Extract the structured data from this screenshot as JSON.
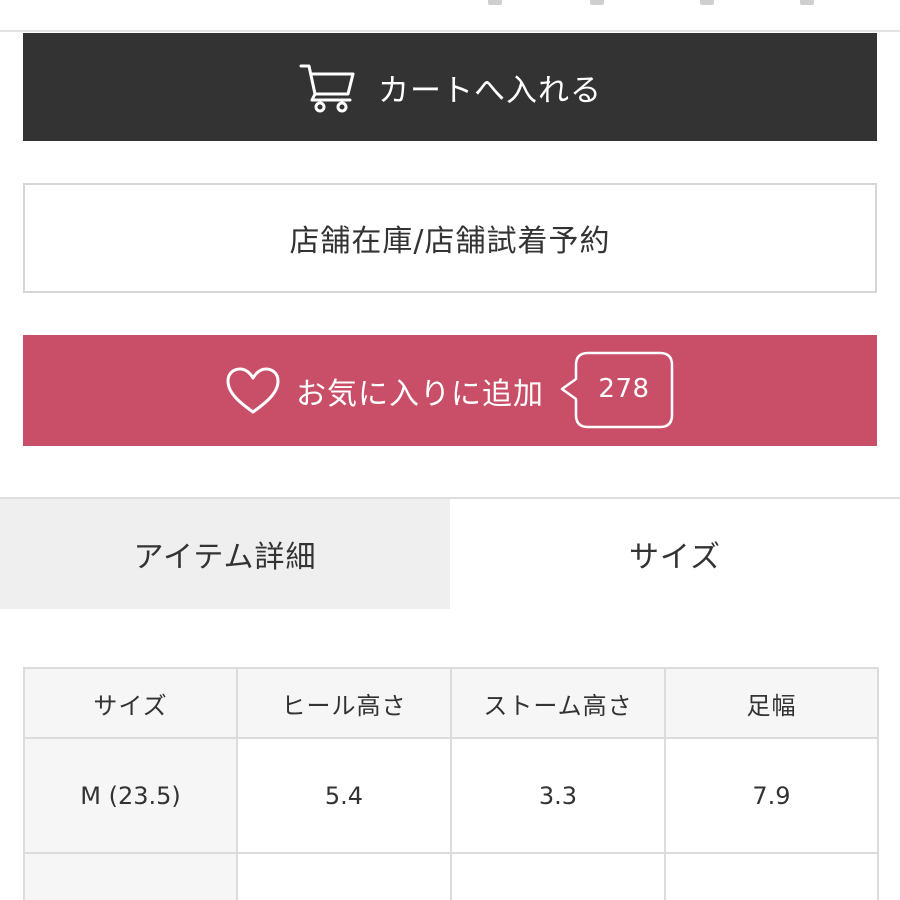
{
  "actions": {
    "cart_label": "カートへ入れる",
    "store_label": "店舗在庫/店舗試着予約",
    "favorite_label": "お気に入りに追加",
    "favorite_count": "278"
  },
  "tabs": [
    {
      "label": "アイテム詳細",
      "active": false
    },
    {
      "label": "サイズ",
      "active": true
    }
  ],
  "size_table": {
    "headers": [
      "サイズ",
      "ヒール高さ",
      "ストーム高さ",
      "足幅"
    ],
    "rows": [
      [
        "M (23.5)",
        "5.4",
        "3.3",
        "7.9"
      ]
    ]
  },
  "icons": {
    "cart": "cart-icon",
    "favorite": "heart-icon",
    "count_bubble": "speech-bubble-icon"
  },
  "colors": {
    "cart_button": "#333333",
    "favorite_button": "#c94f68",
    "inactive_tab": "#efefef",
    "table_header_bg": "#f6f6f6",
    "border": "#dcdcdc"
  }
}
